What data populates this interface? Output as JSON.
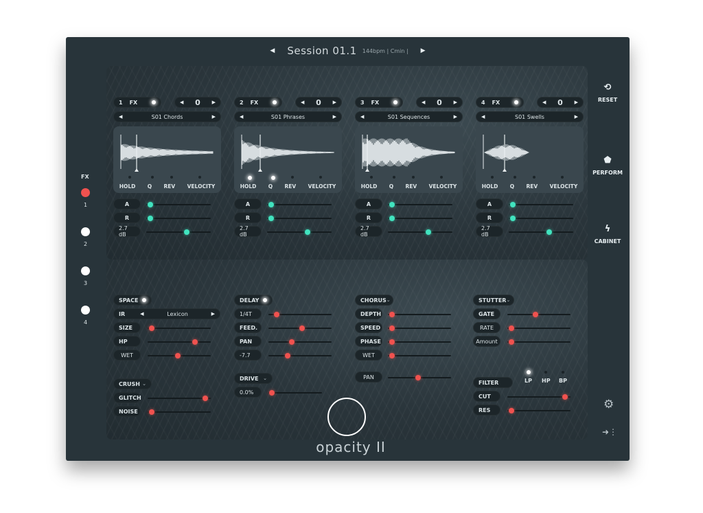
{
  "session": {
    "name": "Session 01.1",
    "info": "144bpm | Cmin |",
    "prev": "◀",
    "next": "▶"
  },
  "channels": [
    {
      "num": "1",
      "fx": "FX",
      "value": "0",
      "preset": "S01 Chords",
      "a": 0.02,
      "r": 0.02,
      "gain_label": "2.7 dB",
      "gain": 0.64
    },
    {
      "num": "2",
      "fx": "FX",
      "value": "0",
      "preset": "S01 Phrases",
      "a": 0.02,
      "r": 0.02,
      "gain_label": "2.7 dB",
      "gain": 0.64
    },
    {
      "num": "3",
      "fx": "FX",
      "value": "0",
      "preset": "S01 Sequences",
      "a": 0.02,
      "r": 0.02,
      "gain_label": "2.7 dB",
      "gain": 0.64
    },
    {
      "num": "4",
      "fx": "FX",
      "value": "0",
      "preset": "S01 Swells",
      "a": 0.02,
      "r": 0.02,
      "gain_label": "2.7 dB",
      "gain": 0.64
    }
  ],
  "channel_controls": {
    "hold": "HOLD",
    "q": "Q",
    "rev": "REV",
    "velocity": "VELOCITY",
    "attack": "A",
    "release": "R"
  },
  "left_nav": {
    "title": "FX",
    "items": [
      "1",
      "2",
      "3",
      "4"
    ],
    "active": 0
  },
  "right_nav": {
    "reset": "RESET",
    "perform": "PERFORM",
    "cabinet": "CABINET"
  },
  "effects": {
    "space": {
      "label": "SPACE",
      "ir_label": "IR",
      "ir_value": "Lexicon",
      "size": "SIZE",
      "size_v": 0.02,
      "hp": "HP",
      "hp_v": 0.77,
      "wet": "WET",
      "wet_v": 0.48
    },
    "delay": {
      "label": "DELAY",
      "time": "1/4T",
      "time_v": 0.1,
      "feed": "FEED.",
      "feed_v": 0.54,
      "pan": "PAN",
      "pan_v": 0.36,
      "val_label": "-7.7",
      "val_v": 0.28
    },
    "chorus": {
      "label": "CHORUS",
      "depth": "DEPTH",
      "depth_v": 0.02,
      "speed": "SPEED",
      "speed_v": 0.02,
      "phase": "PHASE",
      "phase_v": 0.02,
      "wet": "WET",
      "wet_v": 0.02
    },
    "pan": {
      "label": "PAN",
      "v": 0.48
    },
    "stutter": {
      "label": "STUTTER",
      "gate": "GATE",
      "gate_v": 0.44,
      "rate": "RATE",
      "rate_v": 0.02,
      "amount": "Amount",
      "amount_v": 0.02
    },
    "crush": {
      "label": "CRUSH",
      "glitch": "GLITCH",
      "glitch_v": 0.95,
      "noise": "NOISE",
      "noise_v": 0.02
    },
    "drive": {
      "label": "DRIVE",
      "val_label": "0.0%",
      "v": 0.02
    },
    "filter": {
      "label": "FILTER",
      "modes": [
        "LP",
        "HP",
        "BP"
      ],
      "active": 0,
      "cut": "CUT",
      "cut_v": 0.95,
      "res": "RES",
      "res_v": 0.02
    }
  },
  "brand": {
    "logo": "opacity II"
  },
  "colors": {
    "accent_green": "#41e3bf",
    "accent_red": "#f0524f",
    "panel": "#28343a"
  }
}
